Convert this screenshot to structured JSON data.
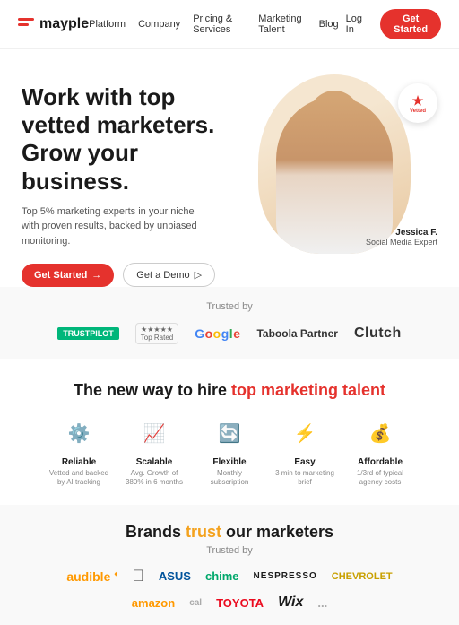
{
  "nav": {
    "logo_text": "mayple",
    "links": [
      {
        "label": "Platform"
      },
      {
        "label": "Company"
      },
      {
        "label": "Pricing & Services"
      },
      {
        "label": "Marketing Talent"
      },
      {
        "label": "Blog"
      }
    ],
    "login": "Log In",
    "cta": "Get Started"
  },
  "hero": {
    "title": "Work with top vetted marketers. Grow your business.",
    "subtitle": "Top 5% marketing experts in your niche with proven results, backed by unbiased monitoring.",
    "btn_start": "Get Started",
    "btn_demo": "Get a Demo",
    "person_name": "Jessica F.",
    "person_role": "Social Media Expert",
    "vetted_text": "Vetted"
  },
  "trusted1": {
    "label": "Trusted by",
    "logos": [
      {
        "id": "trustpilot",
        "text": "TRUSTPILOT"
      },
      {
        "id": "toprated",
        "text": "Top Rated"
      },
      {
        "id": "google",
        "text": "Google"
      },
      {
        "id": "taboola",
        "text": "Taboola Partner"
      },
      {
        "id": "clutch",
        "text": "Clutch"
      }
    ]
  },
  "newway": {
    "title_part1": "The new way to hire ",
    "title_highlight": "top marketing talent",
    "features": [
      {
        "icon": "⚙️",
        "name": "Reliable",
        "desc": "Vetted and backed by AI tracking"
      },
      {
        "icon": "📈",
        "name": "Scalable",
        "desc": "Avg. Growth of 380% in 6 months"
      },
      {
        "icon": "🔄",
        "name": "Flexible",
        "desc": "Monthly subscription"
      },
      {
        "icon": "⚡",
        "name": "Easy",
        "desc": "3 min to marketing brief"
      },
      {
        "icon": "💰",
        "name": "Affordable",
        "desc": "1/3rd of typical agency costs"
      }
    ]
  },
  "brands": {
    "title_part1": "Brands ",
    "title_highlight": "trust",
    "title_part2": " our marketers",
    "trusted_label": "Trusted by",
    "logos_row1": [
      {
        "id": "audible",
        "text": "audible"
      },
      {
        "id": "apple",
        "text": ""
      },
      {
        "id": "asus",
        "text": "ASUS"
      },
      {
        "id": "chime",
        "text": "chime"
      },
      {
        "id": "nespresso",
        "text": "NESPRESSO"
      },
      {
        "id": "chevrolet",
        "text": "CHEVROLET"
      }
    ],
    "logos_row2": [
      {
        "id": "amazon",
        "text": "amazon"
      },
      {
        "id": "cal",
        "text": "cal"
      },
      {
        "id": "toyota",
        "text": "TOYOTA"
      },
      {
        "id": "wix",
        "text": "Wix"
      },
      {
        "id": "more",
        "text": "..."
      }
    ]
  }
}
